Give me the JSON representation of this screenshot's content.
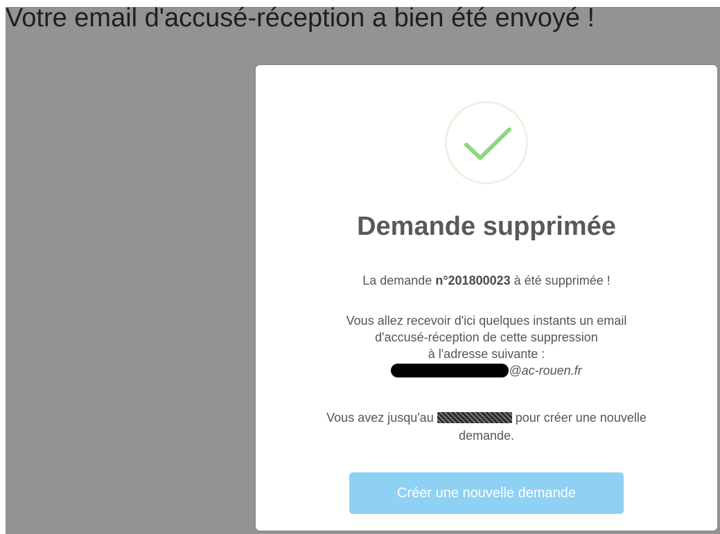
{
  "page": {
    "heading": "Votre email d'accusé-réception a bien été envoyé !"
  },
  "modal": {
    "title": "Demande supprimée",
    "request": {
      "prefix": "La demande ",
      "number": "n°201800023",
      "suffix": " à été supprimée !"
    },
    "info_lines": [
      "Vous allez recevoir d'ici quelques instants un email",
      "d'accusé-réception de cette suppression",
      "à l'adresse suivante :"
    ],
    "email_domain": "@ac-rouen.fr",
    "deadline": {
      "prefix": "Vous avez jusqu'au ",
      "suffix": " pour créer une nouvelle",
      "line2": "demande."
    },
    "create_button_label": "Créer une nouvelle demande"
  },
  "colors": {
    "backdrop": "#939393",
    "check": "#8fd67e",
    "button": "#8fd1f3"
  },
  "icons": {
    "success": "checkmark-icon"
  }
}
